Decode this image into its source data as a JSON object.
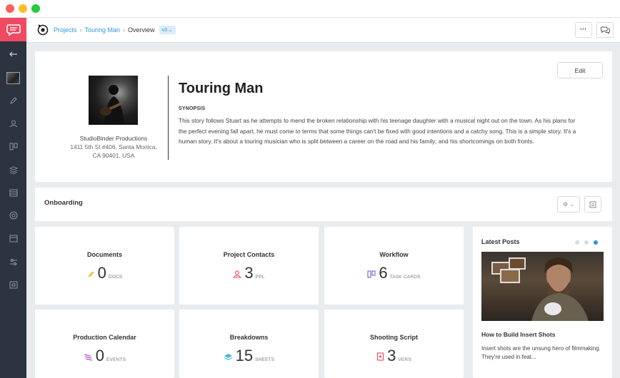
{
  "breadcrumb": {
    "projects": "Projects",
    "project": "Touring Man",
    "current": "Overview",
    "version": "v3 ⌄"
  },
  "topbar": {
    "more_label": "•••"
  },
  "profile": {
    "title": "Touring Man",
    "company": "StudioBinder Productions",
    "address_line1": "1411 5th St #406, Santa Monica,",
    "address_line2": "CA 90401, USA",
    "synopsis_label": "SYNOPSIS",
    "synopsis": "This story follows Stuart as he attempts to mend the broken relationship with his teenage daughter with a musical night out on the town. As his plans for the perfect evening fall apart, he must come to terms that some things can't be fixed with good intentions and a catchy song. This is a simple story. It's a human story. It's about a touring musician who is split between a career on the road and his family; and his shortcomings on both fronts.",
    "edit_label": "Edit"
  },
  "onboarding": {
    "title": "Onboarding",
    "settings_label": "⚙ ⌄"
  },
  "tiles": [
    {
      "title": "Documents",
      "value": "0",
      "unit": "DOCS",
      "icon": "pencil-icon",
      "color": "#f5a623"
    },
    {
      "title": "Project Contacts",
      "value": "3",
      "unit": "PPL",
      "icon": "contacts-icon",
      "color": "#ef4a62"
    },
    {
      "title": "Workflow",
      "value": "6",
      "unit": "TASK CARDS",
      "icon": "workflow-icon",
      "color": "#6f63d9"
    },
    {
      "title": "Production Calendar",
      "value": "0",
      "unit": "EVENTS",
      "icon": "calendar-stack-icon",
      "color": "#c86dd7"
    },
    {
      "title": "Breakdowns",
      "value": "15",
      "unit": "SHEETS",
      "icon": "breakdown-icon",
      "color": "#3fb8e0"
    },
    {
      "title": "Shooting Script",
      "value": "3",
      "unit": "VERS",
      "icon": "script-icon",
      "color": "#ef4a62"
    }
  ],
  "posts": {
    "title": "Latest Posts",
    "post_title": "How to Build Insert Shots",
    "excerpt": "Insert shots are the unsung hero of filmmaking. They're used in feat..."
  },
  "colors": {
    "accent": "#2f95d8",
    "brand": "#ef4a62",
    "sidebar": "#2c3440"
  }
}
